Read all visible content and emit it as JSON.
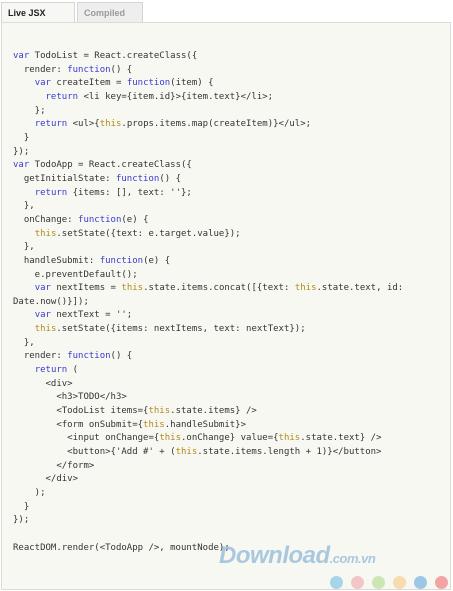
{
  "tabs": {
    "active": "Live JSX Editor",
    "inactive": "Compiled JS"
  },
  "code_lines": [
    "var TodoList = React.createClass({",
    "  render: function() {",
    "    var createItem = function(item) {",
    "      return <li key={item.id}>{item.text}</li>;",
    "    };",
    "    return <ul>{this.props.items.map(createItem)}</ul>;",
    "  }",
    "});",
    "var TodoApp = React.createClass({",
    "  getInitialState: function() {",
    "    return {items: [], text: ''};",
    "  },",
    "  onChange: function(e) {",
    "    this.setState({text: e.target.value});",
    "  },",
    "  handleSubmit: function(e) {",
    "    e.preventDefault();",
    "    var nextItems = this.state.items.concat([{text: this.state.text, id:",
    "Date.now()}]);",
    "    var nextText = '';",
    "    this.setState({items: nextItems, text: nextText});",
    "  },",
    "  render: function() {",
    "    return (",
    "      <div>",
    "        <h3>TODO</h3>",
    "        <TodoList items={this.state.items} />",
    "        <form onSubmit={this.handleSubmit}>",
    "          <input onChange={this.onChange} value={this.state.text} />",
    "          <button>{'Add #' + (this.state.items.length + 1)}</button>",
    "        </form>",
    "      </div>",
    "    );",
    "  }",
    "});",
    "",
    "ReactDOM.render(<TodoApp />, mountNode);"
  ],
  "watermark": {
    "brand": "Download",
    "domain": ".com.vn"
  },
  "colors": {
    "editor_bg": "#f8f8f3",
    "keyword": "#3a3ad0",
    "accent": "#b08a1b",
    "dots": [
      "#a8d4ea",
      "#f2c6c6",
      "#c9e6b3",
      "#f6dcae",
      "#9cc7e6",
      "#f2a3a3"
    ]
  }
}
